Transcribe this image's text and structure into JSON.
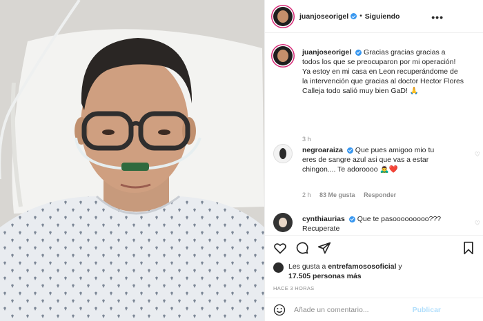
{
  "header": {
    "username": "juanjoseorigel",
    "separator": "•",
    "follow_status": "Siguiendo",
    "more_icon": "more-horizontal-icon"
  },
  "caption": {
    "username": "juanjoseorigel",
    "text": "Gracias gracias gracias a todos los que se preocuparon por mi operación! Ya estoy en mi casa en Leon recuperándome de la intervención que gracias al doctor Hector Flores Calleja todo salió muy bien GaD! 🙏",
    "time": "3 h"
  },
  "comments": [
    {
      "username": "negroaraiza",
      "text": "Que pues amigoo mio tu eres de sangre azul asi que vas a estar chingon.... Te adoroooo 🙇‍♂️❤️",
      "time": "2 h",
      "likes": "83 Me gusta",
      "reply": "Responder"
    },
    {
      "username": "cynthiaurias",
      "text": "Que te pasooooooooo??? Recuperate"
    }
  ],
  "likes": {
    "text": "Les gusta a entrefamososoficial y 17.505 personas más",
    "prefix": "Les gusta a ",
    "user": "entrefamososoficial",
    "middle": " y",
    "count": "17.505 personas más"
  },
  "time_ago": "HACE 3 HORAS",
  "comment_box": {
    "placeholder": "Añade un comentario...",
    "publish": "Publicar"
  },
  "colors": {
    "verified": "#3897f0",
    "heart": "#ed4956",
    "publish_disabled": "#b2dffc",
    "muted": "#8e8e8e"
  }
}
